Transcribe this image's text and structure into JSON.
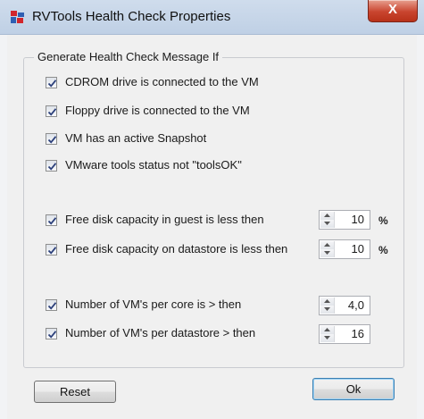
{
  "window": {
    "title": "RVTools Health Check Properties",
    "close_glyph": "X"
  },
  "group": {
    "title": "Generate Health Check Message If"
  },
  "checks": [
    {
      "label": "CDROM drive is connected to the VM",
      "checked": true
    },
    {
      "label": "Floppy drive is connected to the VM",
      "checked": true
    },
    {
      "label": "VM has an active Snapshot",
      "checked": true
    },
    {
      "label": "VMware tools status not \"toolsOK\"",
      "checked": true
    },
    {
      "label": "Free disk capacity in guest is less then",
      "checked": true
    },
    {
      "label": "Free disk capacity on datastore is less then",
      "checked": true
    },
    {
      "label": "Number of VM's per core is > then",
      "checked": true
    },
    {
      "label": "Number of VM's per datastore > then",
      "checked": true
    }
  ],
  "spinners": [
    {
      "value": "10",
      "unit": "%"
    },
    {
      "value": "10",
      "unit": "%"
    },
    {
      "value": "4,0"
    },
    {
      "value": "16"
    }
  ],
  "buttons": {
    "reset": "Reset",
    "ok": "Ok"
  },
  "colors": {
    "titlebar": "#c5d5e9",
    "close_button": "#c9452f",
    "face": "#f0f0f0",
    "checkmark": "#2b3f7a"
  },
  "icons": {
    "app": "rvtools-app-icon",
    "checkmark": "checkmark-icon",
    "spin_up": "spin-up-arrow-icon",
    "spin_down": "spin-down-arrow-icon"
  }
}
